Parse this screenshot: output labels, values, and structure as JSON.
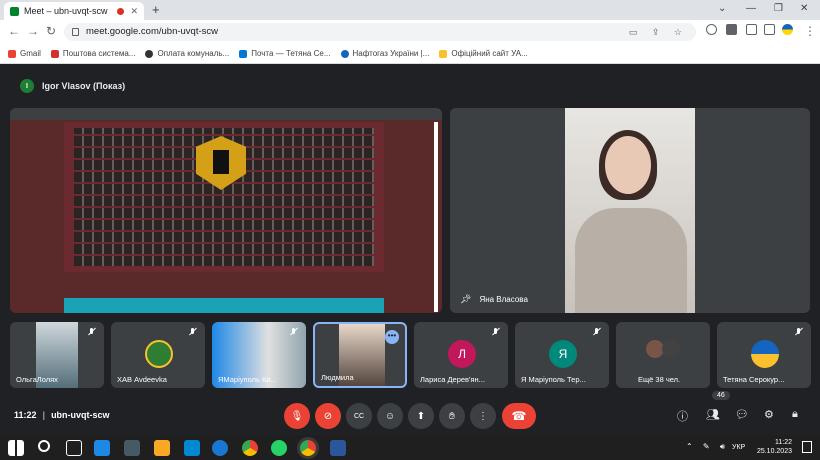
{
  "browser": {
    "tab_title": "Meet – ubn-uvqt-scw",
    "new_tab": "+",
    "url": "meet.google.com/ubn-uvqt-scw",
    "bookmarks": [
      "Gmail",
      "Поштова система...",
      "Оплата комуналь...",
      "Почта — Тетяна Се...",
      "Нафтогаз України |...",
      "Офіційний сайт УА..."
    ]
  },
  "meet": {
    "presenter_initial": "I",
    "presenter_label": "Igor Vlasov (Показ)",
    "speaker_name": "Яна Власова",
    "tiles": [
      {
        "name": "ОльгаЛолях"
      },
      {
        "name": "ХАВ Avdeevka"
      },
      {
        "name": "ЯМаріуполь Ки..."
      },
      {
        "name": "Людмила"
      },
      {
        "name": "Лариса Дерев'ян...",
        "initial": "Л",
        "color": "#c2185b"
      },
      {
        "name": "Я Маріуполь Тер...",
        "initial": "Я",
        "color": "#00897b"
      },
      {
        "name": "Ещё 38 чел."
      },
      {
        "name": "Тетяна Серокур..."
      }
    ],
    "time": "11:22",
    "meeting_code": "ubn-uvqt-scw",
    "participants_count": "46"
  },
  "taskbar": {
    "lang": "УКР",
    "clock": "11:22",
    "date": "25.10.2023"
  }
}
